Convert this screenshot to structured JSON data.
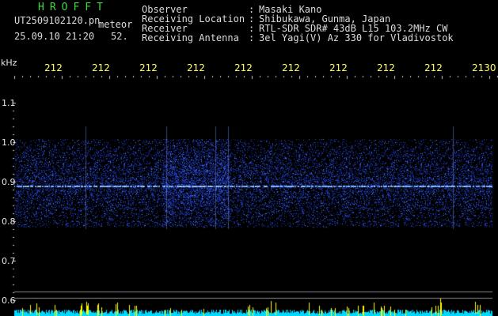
{
  "title": "HROFFT",
  "file_name": "UT2509102120.pn",
  "file_tag": "meteor",
  "timestamp": "25.09.10 21:20",
  "count": "52.",
  "info": {
    "labels": [
      "Observer",
      "Receiving Location",
      "Receiver",
      "Receiving Antenna"
    ],
    "separators": [
      ":",
      ":",
      ":",
      ":"
    ],
    "values": [
      "Masaki Kano",
      "Shibukawa, Gunma, Japan",
      "RTL-SDR SDR# 43dB L15 103.2MHz CW",
      "3el Yagi(V) Az 330 for Vladivostok"
    ]
  },
  "y_axis": {
    "unit": "kHz",
    "ticks": [
      "1.1",
      "1.0",
      "0.9",
      "0.8",
      "0.7",
      "0.6"
    ]
  },
  "x_axis": {
    "ticks": [
      "212",
      "212",
      "212",
      "212",
      "212",
      "212",
      "212",
      "212",
      "212",
      "2130"
    ]
  },
  "colors": {
    "background": "#000000",
    "signal": "#2a4fd8",
    "carrier": "#6aa8ff",
    "meteor": "#ffff00",
    "baseline": "#00d8ff",
    "grid": "#8a8a8a"
  }
}
